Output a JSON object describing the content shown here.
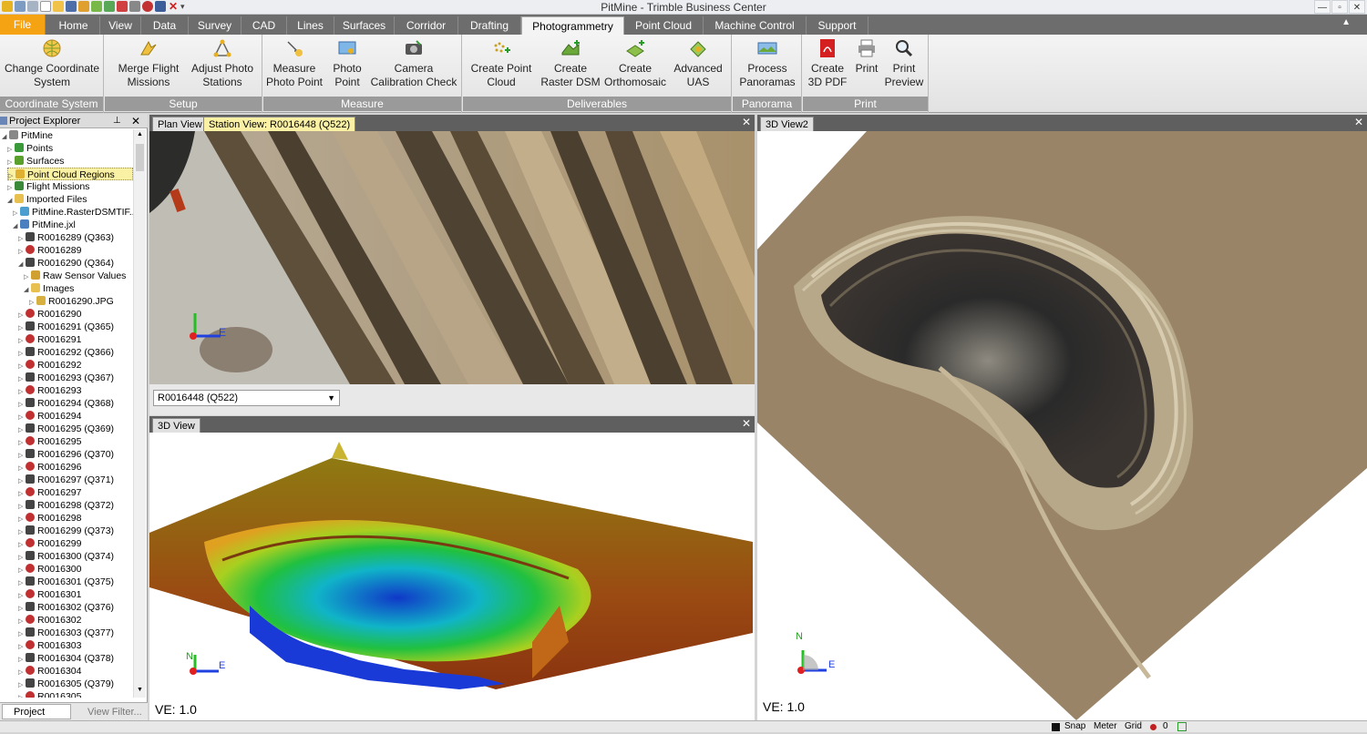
{
  "app": {
    "title": "PitMine - Trimble Business Center"
  },
  "tabs": [
    "File",
    "Home",
    "View",
    "Data",
    "Survey",
    "CAD",
    "Lines",
    "Surfaces",
    "Corridor",
    "Drafting",
    "Photogrammetry",
    "Point Cloud",
    "Machine Control",
    "Support"
  ],
  "active_tab": "Photogrammetry",
  "ribbon": {
    "groups": [
      {
        "label": "Coordinate System",
        "buttons": [
          {
            "l1": "Change Coordinate",
            "l2": "System",
            "icon": "globe-icon"
          }
        ]
      },
      {
        "label": "Setup",
        "buttons": [
          {
            "l1": "Merge Flight",
            "l2": "Missions",
            "icon": "merge-icon"
          },
          {
            "l1": "Adjust Photo",
            "l2": "Stations",
            "icon": "adjust-icon"
          }
        ]
      },
      {
        "label": "Measure",
        "buttons": [
          {
            "l1": "Measure",
            "l2": "Photo Point",
            "icon": "measure-icon"
          },
          {
            "l1": "Photo",
            "l2": "Point",
            "icon": "photo-point-icon"
          },
          {
            "l1": "Camera",
            "l2": "Calibration Check",
            "icon": "camera-icon"
          }
        ]
      },
      {
        "label": "Deliverables",
        "buttons": [
          {
            "l1": "Create Point",
            "l2": "Cloud",
            "icon": "point-cloud-icon"
          },
          {
            "l1": "Create",
            "l2": "Raster DSM",
            "icon": "dsm-icon"
          },
          {
            "l1": "Create",
            "l2": "Orthomosaic",
            "icon": "ortho-icon"
          },
          {
            "l1": "Advanced",
            "l2": "UAS",
            "icon": "uas-icon"
          }
        ]
      },
      {
        "label": "Panorama",
        "buttons": [
          {
            "l1": "Process",
            "l2": "Panoramas",
            "icon": "panorama-icon"
          }
        ]
      },
      {
        "label": "Print",
        "buttons": [
          {
            "l1": "Create",
            "l2": "3D PDF",
            "icon": "pdf-icon"
          },
          {
            "l1": "Print",
            "l2": "",
            "icon": "print-icon"
          },
          {
            "l1": "Print",
            "l2": "Preview",
            "icon": "preview-icon"
          }
        ]
      }
    ]
  },
  "explorer": {
    "title": "Project Explorer",
    "items": [
      {
        "text": "PitMine",
        "depth": 0,
        "icon": "project-icon",
        "color": "#888888"
      },
      {
        "text": "Points",
        "depth": 1,
        "icon": "points-icon",
        "color": "#3a9a3a"
      },
      {
        "text": "Surfaces",
        "depth": 1,
        "icon": "surfaces-icon",
        "color": "#5aa02c"
      },
      {
        "text": "Point Cloud Regions",
        "depth": 1,
        "icon": "cloud-region-icon",
        "color": "#e0b030",
        "highlight": true
      },
      {
        "text": "Flight Missions",
        "depth": 1,
        "icon": "flight-icon",
        "color": "#3a8a3a"
      },
      {
        "text": "Imported Files",
        "depth": 1,
        "icon": "folder-icon",
        "color": "#e8c050"
      },
      {
        "text": "PitMine.RasterDSMTIF...",
        "depth": 2,
        "icon": "raster-icon",
        "color": "#4a9fd0"
      },
      {
        "text": "PitMine.jxl",
        "depth": 2,
        "icon": "jxl-icon",
        "color": "#4a80c0"
      },
      {
        "text": "R0016289 (Q363)",
        "depth": 3,
        "icon": "station-icon",
        "color": "#444444"
      },
      {
        "text": "R0016289",
        "depth": 3,
        "icon": "target-icon",
        "color": "#c03030"
      },
      {
        "text": "R0016290 (Q364)",
        "depth": 3,
        "icon": "station-icon",
        "color": "#444444"
      },
      {
        "text": "Raw Sensor Values",
        "depth": 4,
        "icon": "sensor-icon",
        "color": "#d0a030"
      },
      {
        "text": "Images",
        "depth": 4,
        "icon": "folder-icon",
        "color": "#e8c050"
      },
      {
        "text": "R0016290.JPG",
        "depth": 5,
        "icon": "image-icon",
        "color": "#d8b040"
      },
      {
        "text": "R0016290",
        "depth": 3,
        "icon": "target-icon",
        "color": "#c03030"
      },
      {
        "text": "R0016291 (Q365)",
        "depth": 3,
        "icon": "station-icon",
        "color": "#444444"
      },
      {
        "text": "R0016291",
        "depth": 3,
        "icon": "target-icon",
        "color": "#c03030"
      },
      {
        "text": "R0016292 (Q366)",
        "depth": 3,
        "icon": "station-icon",
        "color": "#444444"
      },
      {
        "text": "R0016292",
        "depth": 3,
        "icon": "target-icon",
        "color": "#c03030"
      },
      {
        "text": "R0016293 (Q367)",
        "depth": 3,
        "icon": "station-icon",
        "color": "#444444"
      },
      {
        "text": "R0016293",
        "depth": 3,
        "icon": "target-icon",
        "color": "#c03030"
      },
      {
        "text": "R0016294 (Q368)",
        "depth": 3,
        "icon": "station-icon",
        "color": "#444444"
      },
      {
        "text": "R0016294",
        "depth": 3,
        "icon": "target-icon",
        "color": "#c03030"
      },
      {
        "text": "R0016295 (Q369)",
        "depth": 3,
        "icon": "station-icon",
        "color": "#444444"
      },
      {
        "text": "R0016295",
        "depth": 3,
        "icon": "target-icon",
        "color": "#c03030"
      },
      {
        "text": "R0016296 (Q370)",
        "depth": 3,
        "icon": "station-icon",
        "color": "#444444"
      },
      {
        "text": "R0016296",
        "depth": 3,
        "icon": "target-icon",
        "color": "#c03030"
      },
      {
        "text": "R0016297 (Q371)",
        "depth": 3,
        "icon": "station-icon",
        "color": "#444444"
      },
      {
        "text": "R0016297",
        "depth": 3,
        "icon": "target-icon",
        "color": "#c03030"
      },
      {
        "text": "R0016298 (Q372)",
        "depth": 3,
        "icon": "station-icon",
        "color": "#444444"
      },
      {
        "text": "R0016298",
        "depth": 3,
        "icon": "target-icon",
        "color": "#c03030"
      },
      {
        "text": "R0016299 (Q373)",
        "depth": 3,
        "icon": "station-icon",
        "color": "#444444"
      },
      {
        "text": "R0016299",
        "depth": 3,
        "icon": "target-icon",
        "color": "#c03030"
      },
      {
        "text": "R0016300 (Q374)",
        "depth": 3,
        "icon": "station-icon",
        "color": "#444444"
      },
      {
        "text": "R0016300",
        "depth": 3,
        "icon": "target-icon",
        "color": "#c03030"
      },
      {
        "text": "R0016301 (Q375)",
        "depth": 3,
        "icon": "station-icon",
        "color": "#444444"
      },
      {
        "text": "R0016301",
        "depth": 3,
        "icon": "target-icon",
        "color": "#c03030"
      },
      {
        "text": "R0016302 (Q376)",
        "depth": 3,
        "icon": "station-icon",
        "color": "#444444"
      },
      {
        "text": "R0016302",
        "depth": 3,
        "icon": "target-icon",
        "color": "#c03030"
      },
      {
        "text": "R0016303 (Q377)",
        "depth": 3,
        "icon": "station-icon",
        "color": "#444444"
      },
      {
        "text": "R0016303",
        "depth": 3,
        "icon": "target-icon",
        "color": "#c03030"
      },
      {
        "text": "R0016304 (Q378)",
        "depth": 3,
        "icon": "station-icon",
        "color": "#444444"
      },
      {
        "text": "R0016304",
        "depth": 3,
        "icon": "target-icon",
        "color": "#c03030"
      },
      {
        "text": "R0016305 (Q379)",
        "depth": 3,
        "icon": "station-icon",
        "color": "#444444"
      },
      {
        "text": "R0016305",
        "depth": 3,
        "icon": "target-icon",
        "color": "#c03030"
      }
    ],
    "bottom_tabs": [
      "Project Exp...",
      "View Filter..."
    ]
  },
  "views": {
    "plan_tab": "Plan View",
    "station_tab": "Station View: R0016448 (Q522)",
    "station_select": "R0016448 (Q522)",
    "view3d_tab": "3D View",
    "view3d2_tab": "3D View2",
    "ve_label": "VE: 1.0",
    "ve_label2": "VE: 1.0",
    "axis_n": "N",
    "axis_e": "E"
  },
  "status": {
    "snap": "Snap",
    "units": "Meter",
    "grid": "Grid",
    "count": "0"
  },
  "colors": {
    "file_tab": "#f5a213",
    "tab_bar": "#6d6d6d",
    "group_label": "#9a9a9a",
    "highlight": "#fbf1a4"
  }
}
